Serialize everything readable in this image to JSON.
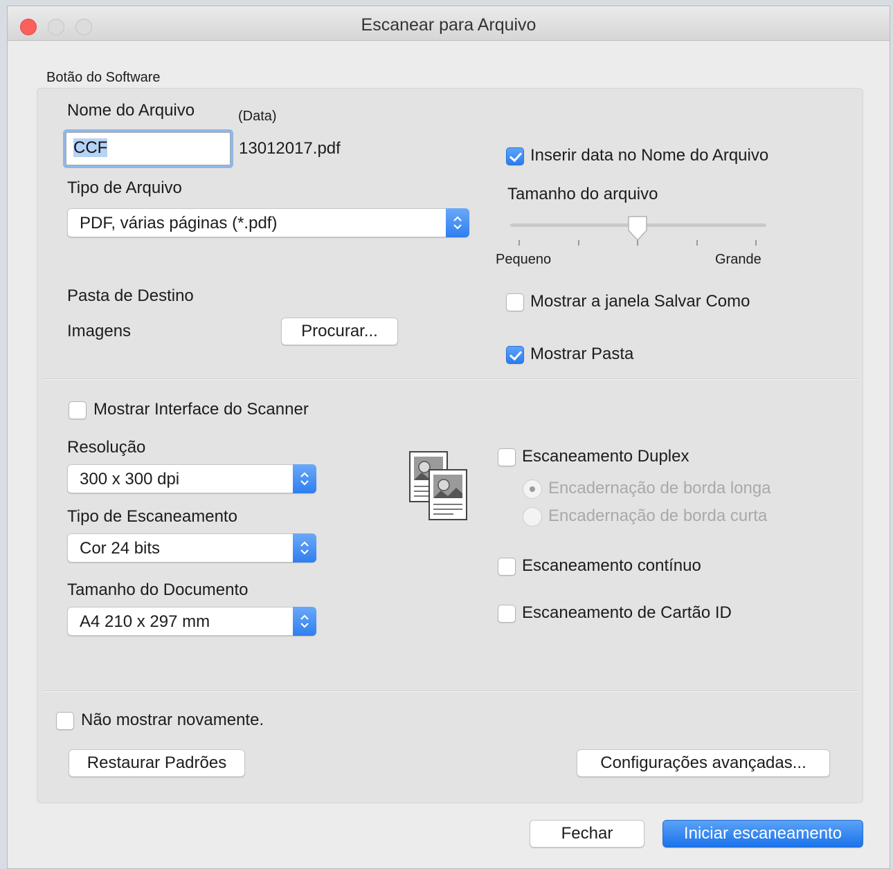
{
  "window": {
    "title": "Escanear para Arquivo"
  },
  "group_label": "Botão do Software",
  "filename": {
    "label": "Nome do Arquivo",
    "date_label": "(Data)",
    "value": "CCF",
    "date_suffix": "13012017.pdf"
  },
  "insert_date": {
    "label": "Inserir data no Nome do Arquivo",
    "checked": true
  },
  "file_type": {
    "label": "Tipo de Arquivo",
    "value": "PDF, várias páginas (*.pdf)"
  },
  "file_size": {
    "label": "Tamanho do arquivo",
    "min_label": "Pequeno",
    "max_label": "Grande",
    "level": 0.5
  },
  "destination": {
    "label": "Pasta de Destino",
    "folder": "Imagens",
    "browse_label": "Procurar..."
  },
  "show_save_as": {
    "label": "Mostrar a janela Salvar Como",
    "checked": false
  },
  "show_folder": {
    "label": "Mostrar Pasta",
    "checked": true
  },
  "show_scanner_ui": {
    "label": "Mostrar Interface do Scanner",
    "checked": false
  },
  "resolution": {
    "label": "Resolução",
    "value": "300 x 300 dpi"
  },
  "scan_type": {
    "label": "Tipo de Escaneamento",
    "value": "Cor 24 bits"
  },
  "document_size": {
    "label": "Tamanho do Documento",
    "value": "A4 210 x 297 mm"
  },
  "duplex": {
    "label": "Escaneamento Duplex",
    "checked": false,
    "long_edge": "Encadernação de borda longa",
    "short_edge": "Encadernação de borda curta"
  },
  "continuous": {
    "label": "Escaneamento contínuo",
    "checked": false
  },
  "id_card": {
    "label": "Escaneamento de Cartão ID",
    "checked": false
  },
  "dont_show": {
    "label": "Não mostrar novamente.",
    "checked": false
  },
  "buttons": {
    "restore": "Restaurar Padrões",
    "advanced": "Configurações avançadas...",
    "close": "Fechar",
    "start": "Iniciar escaneamento"
  },
  "icons": {
    "duplex_icon": "duplex-pages-icon",
    "popup_arrows": "up-down-chevron-icon"
  },
  "colors": {
    "accent": "#2a7cf0",
    "close_light": "#fc605c"
  }
}
